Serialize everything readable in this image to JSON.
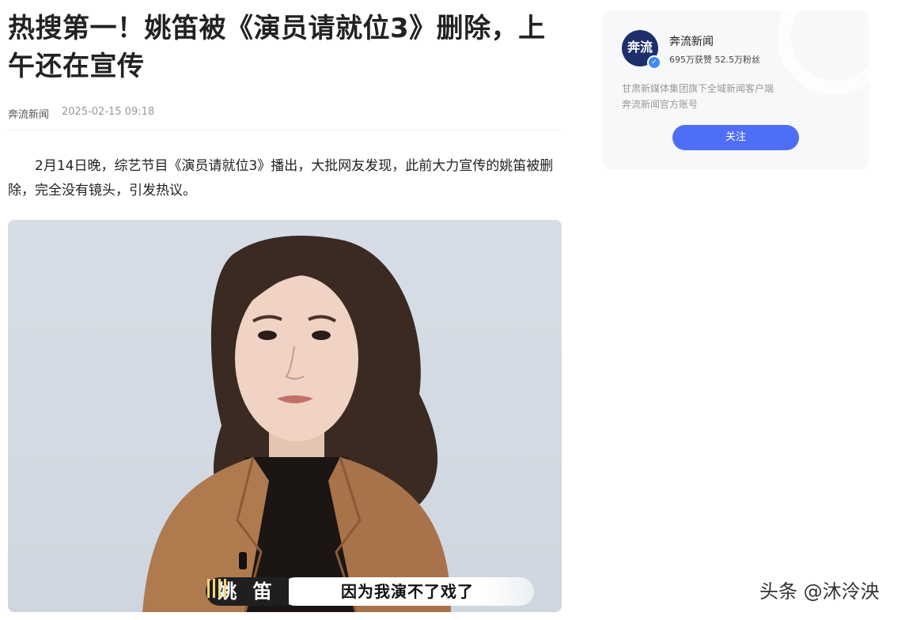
{
  "article": {
    "title": "热搜第一！姚笛被《演员请就位3》删除，上午还在宣传",
    "source": "奔流新闻",
    "time": "2025-02-15 09:18",
    "paragraph": "2月14日晚，综艺节目《演员请就位3》播出，大批网友发现，此前大力宣传的姚笛被删除，完全没有镜头，引发热议。",
    "image": {
      "caption_name": "姚 笛",
      "caption_quote": "因为我演不了戏了"
    }
  },
  "author_card": {
    "avatar_text": "奔流",
    "name": "奔流新闻",
    "stats": "695万获赞 52.5万粉丝",
    "description_line1": "甘肃新媒体集团旗下全域新闻客户端",
    "description_line2": "奔流新闻官方账号",
    "follow_label": "关注",
    "accent_color": "#4f6ef7"
  },
  "watermark": "头条 @沐泠泱"
}
